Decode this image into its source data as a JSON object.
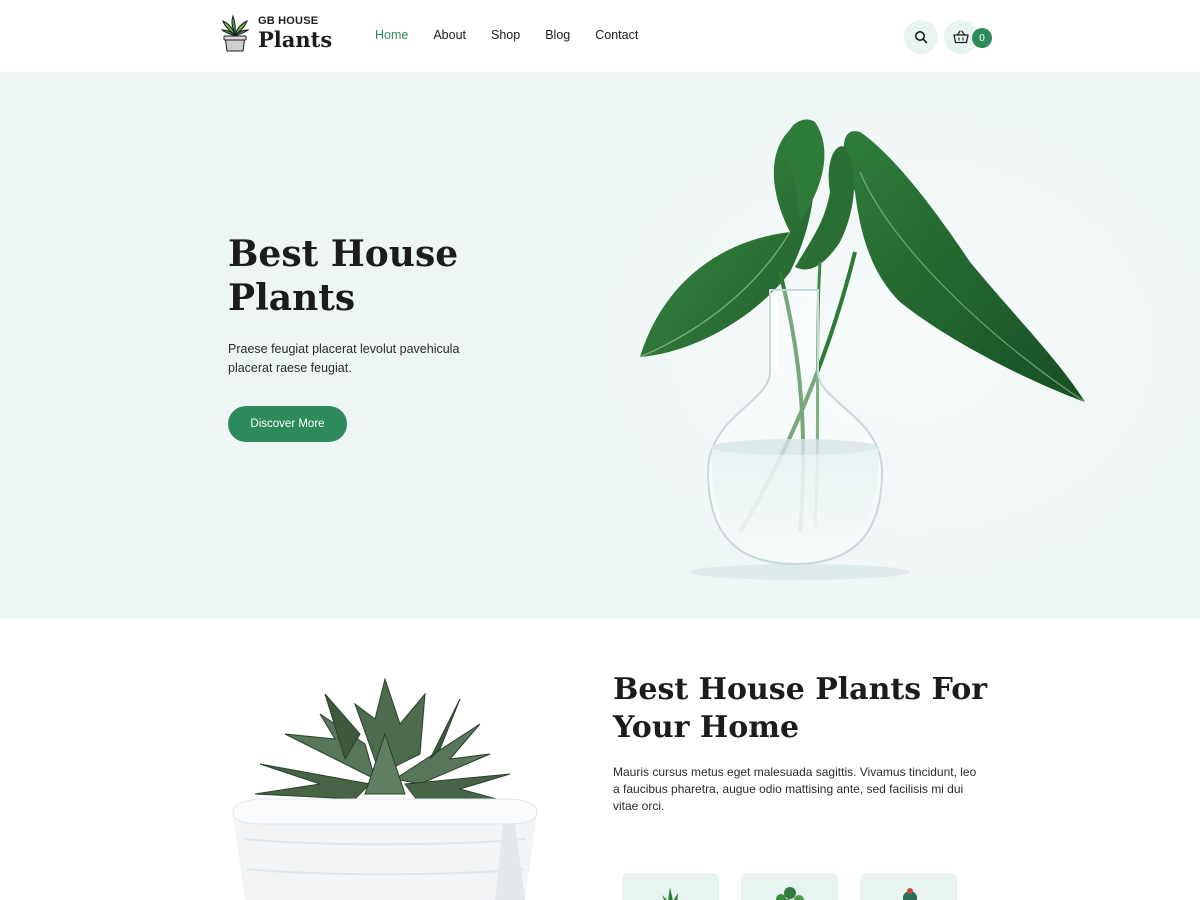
{
  "brand": {
    "small": "GB HOUSE",
    "big": "Plants"
  },
  "nav": [
    {
      "label": "Home",
      "active": true
    },
    {
      "label": "About",
      "active": false
    },
    {
      "label": "Shop",
      "active": false
    },
    {
      "label": "Blog",
      "active": false
    },
    {
      "label": "Contact",
      "active": false
    }
  ],
  "header": {
    "search_icon": "search-icon",
    "cart_icon": "basket-icon",
    "cart_count": "0"
  },
  "hero": {
    "title": "Best House Plants",
    "description": "Praese feugiat placerat levolut pavehicula placerat raese feugiat.",
    "button": "Discover More"
  },
  "about": {
    "title": "Best House Plants For Your Home",
    "description": "Mauris cursus metus eget malesuada sagittis. Vivamus tincidunt, leo a faucibus pharetra, augue odio mattising ante, sed facilisis mi dui vitae orci."
  },
  "colors": {
    "accent": "#2d8a5a",
    "hero_bg": "#eef6f5",
    "chip_bg": "#e8f4f1"
  }
}
